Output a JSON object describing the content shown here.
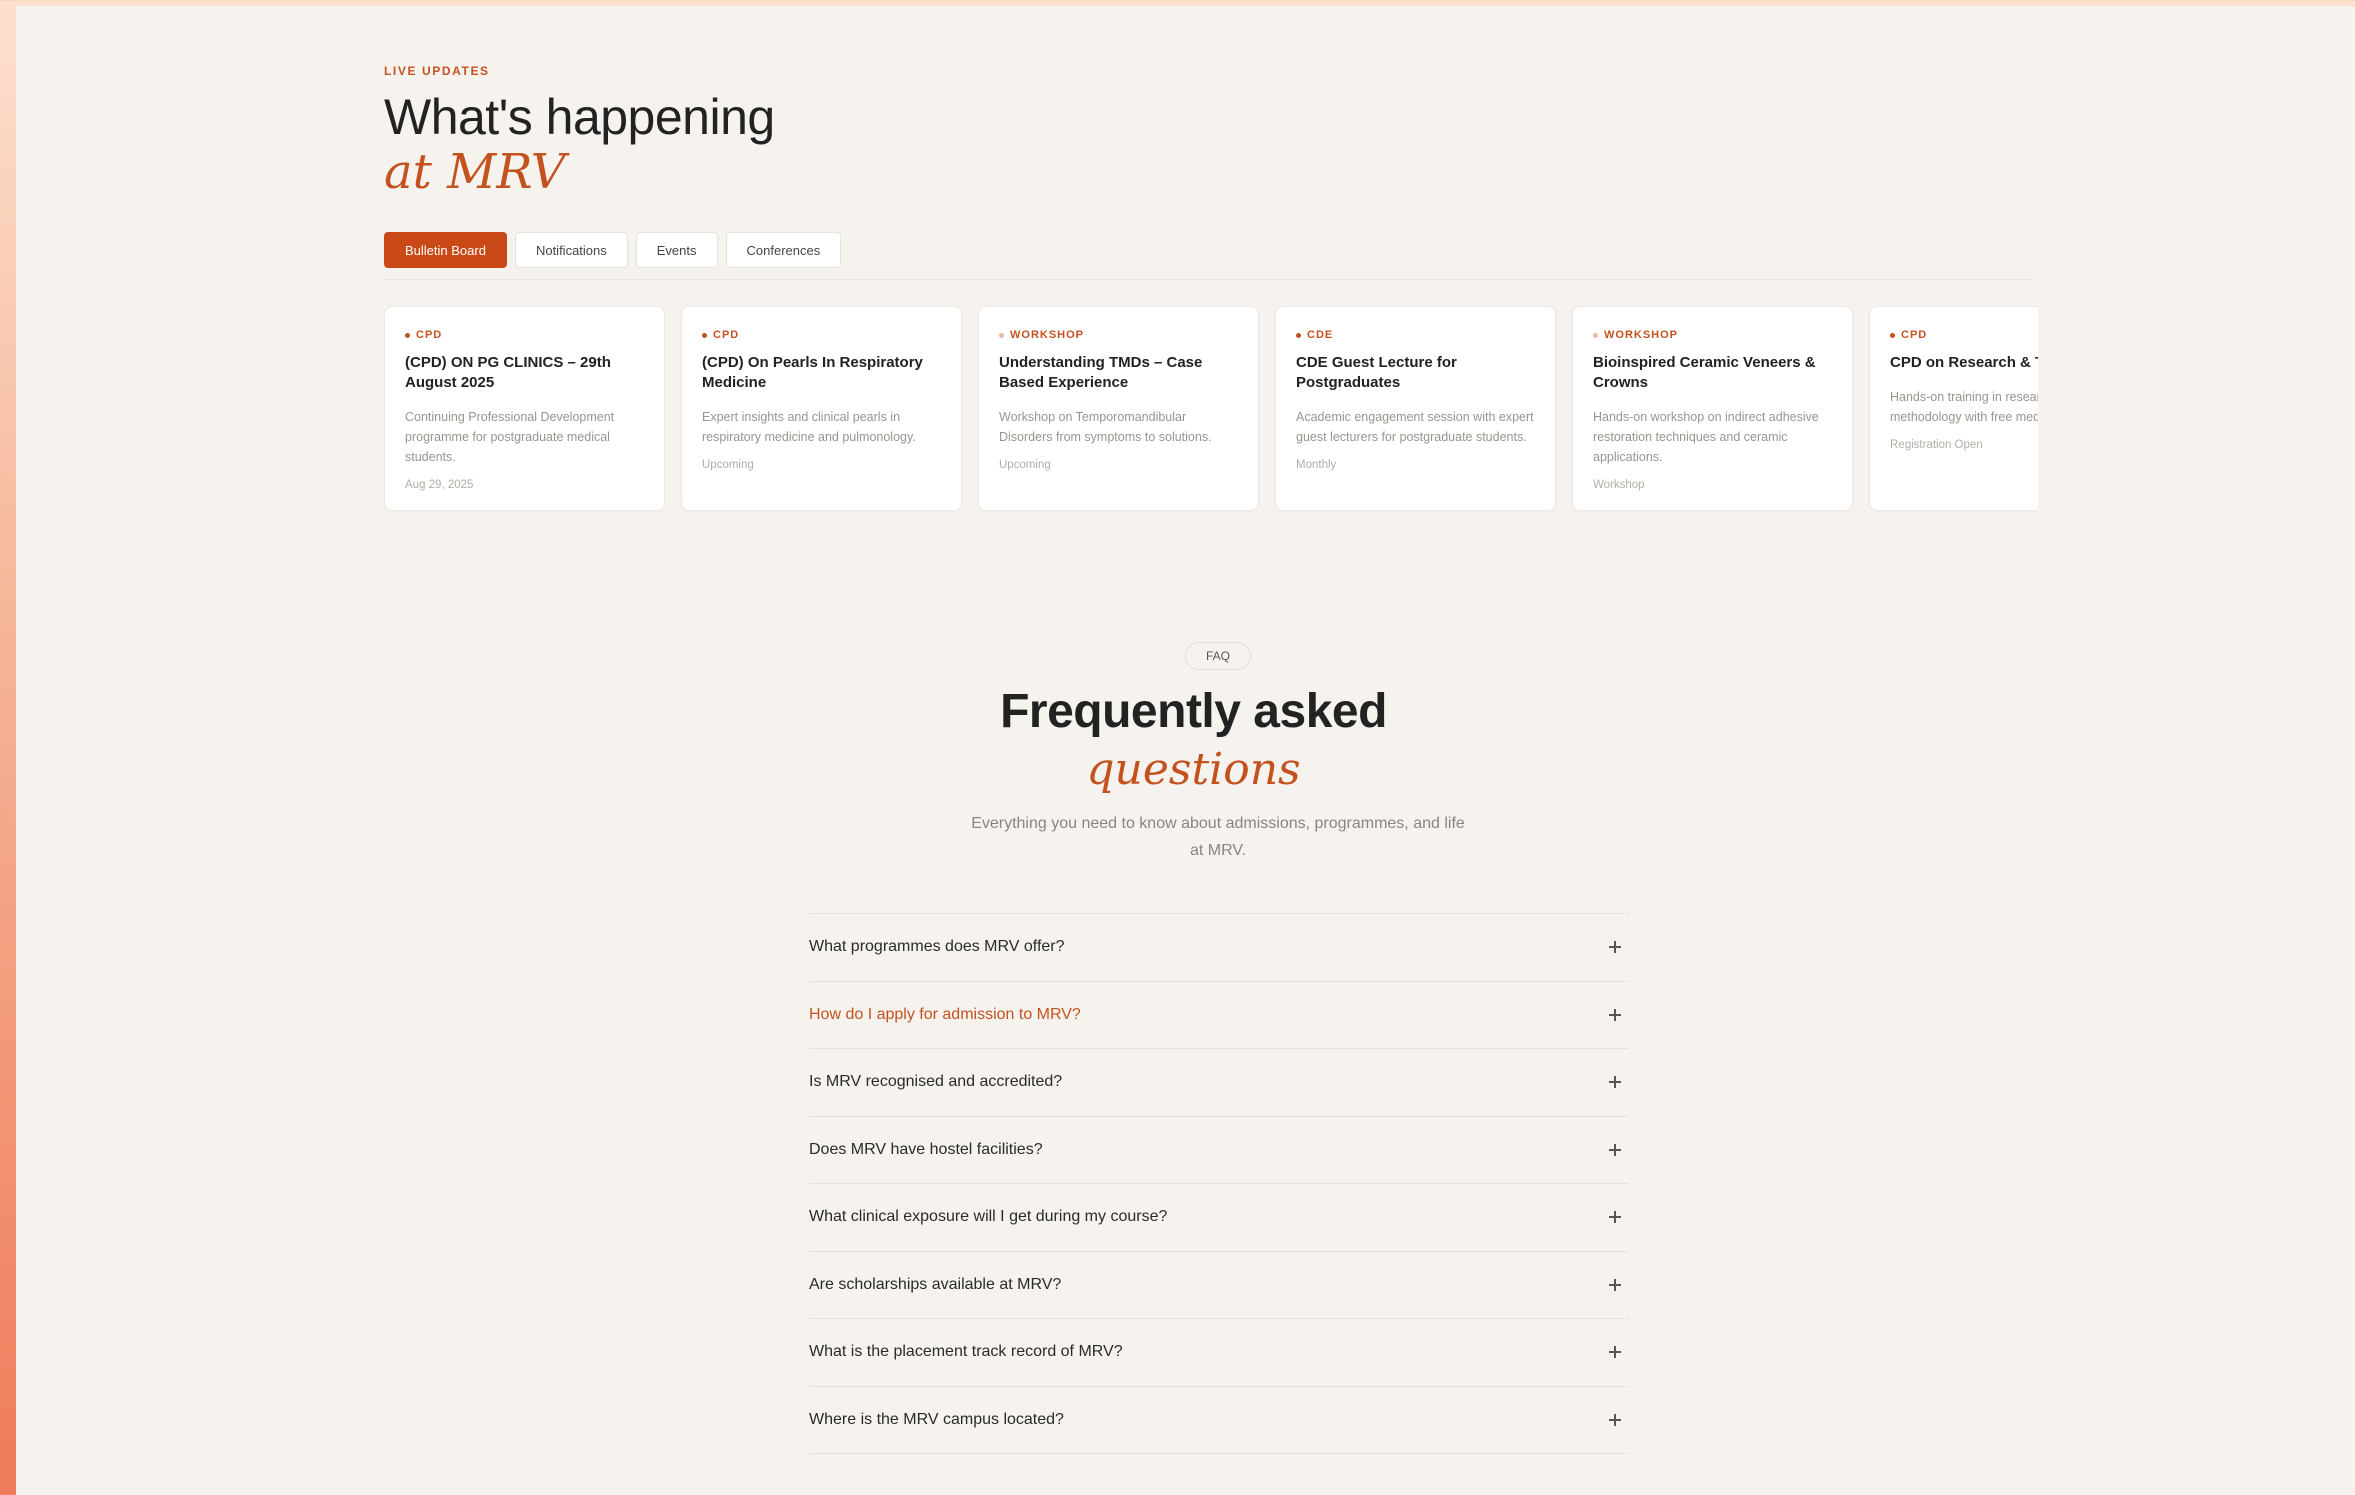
{
  "updates": {
    "eyebrow": "LIVE UPDATES",
    "title": "What's happening",
    "title_accent": "at MRV",
    "tabs": [
      {
        "label": "Bulletin Board",
        "active": true
      },
      {
        "label": "Notifications",
        "active": false
      },
      {
        "label": "Events",
        "active": false
      },
      {
        "label": "Conferences",
        "active": false
      }
    ],
    "cards": [
      {
        "category": "CPD",
        "title": "(CPD) ON PG CLINICS – 29th August 2025",
        "desc": "Continuing Professional Development programme for postgraduate medical students.",
        "meta": "Aug 29, 2025"
      },
      {
        "category": "CPD",
        "title": "(CPD) On Pearls In Respiratory Medicine",
        "desc": "Expert insights and clinical pearls in respiratory medicine and pulmonology.",
        "meta": "Upcoming"
      },
      {
        "category": "WORKSHOP",
        "title": "Understanding TMDs – Case Based Experience",
        "desc": "Workshop on Temporomandibular Disorders from symptoms to solutions.",
        "meta": "Upcoming"
      },
      {
        "category": "CDE",
        "title": "CDE Guest Lecture for Postgraduates",
        "desc": "Academic engagement session with expert guest lecturers for postgraduate students.",
        "meta": "Monthly"
      },
      {
        "category": "WORKSHOP",
        "title": "Bioinspired Ceramic Veneers & Crowns",
        "desc": "Hands-on workshop on indirect adhesive restoration techniques and ceramic applications.",
        "meta": "Workshop"
      },
      {
        "category": "CPD",
        "title": "CPD on Research & Training",
        "desc": "Hands-on training in research methodology with free medical education.",
        "meta": "Registration Open"
      }
    ]
  },
  "faq": {
    "badge": "FAQ",
    "title": "Frequently asked",
    "title_accent": "questions",
    "subtitle": "Everything you need to know about admissions, programmes, and life at MRV.",
    "items": [
      {
        "q": "What programmes does MRV offer?"
      },
      {
        "q": "How do I apply for admission to MRV?"
      },
      {
        "q": "Is MRV recognised and accredited?"
      },
      {
        "q": "Does MRV have hostel facilities?"
      },
      {
        "q": "What clinical exposure will I get during my course?"
      },
      {
        "q": "Are scholarships available at MRV?"
      },
      {
        "q": "What is the placement track record of MRV?"
      },
      {
        "q": "Where is the MRV campus located?"
      }
    ]
  }
}
